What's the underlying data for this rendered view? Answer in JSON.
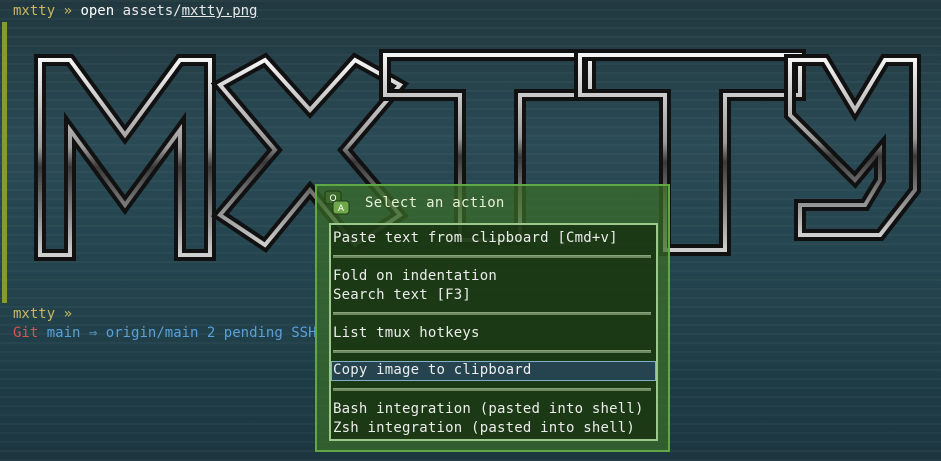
{
  "terminal": {
    "line1": {
      "prompt": "mxtty »",
      "command": "open",
      "args_prefix": "assets/",
      "args_file": "mxtty.png"
    },
    "line2": {
      "prompt": "mxtty »"
    },
    "git": {
      "label": "Git",
      "branch": "main",
      "arrow": "⇒",
      "remote": "origin/main",
      "status": "2 pending",
      "extra": "SSH"
    },
    "logo_text": "mxtty"
  },
  "dialog": {
    "title": "Select an action",
    "icon": "qa-speech-bubbles-icon",
    "items": [
      {
        "label": "Paste text from clipboard [Cmd+v]"
      },
      {
        "label": "Fold on indentation"
      },
      {
        "label": "Search text [F3]"
      },
      {
        "label": "List tmux hotkeys"
      },
      {
        "label": "Copy image to clipboard",
        "selected": true
      },
      {
        "label": "Bash integration (pasted into shell)"
      },
      {
        "label": "Zsh integration (pasted into shell)"
      }
    ]
  },
  "colors": {
    "prompt": "#c9b75e",
    "git_red": "#d9534f",
    "git_blue": "#5aa0d8",
    "dialog_border": "#5fa844"
  }
}
